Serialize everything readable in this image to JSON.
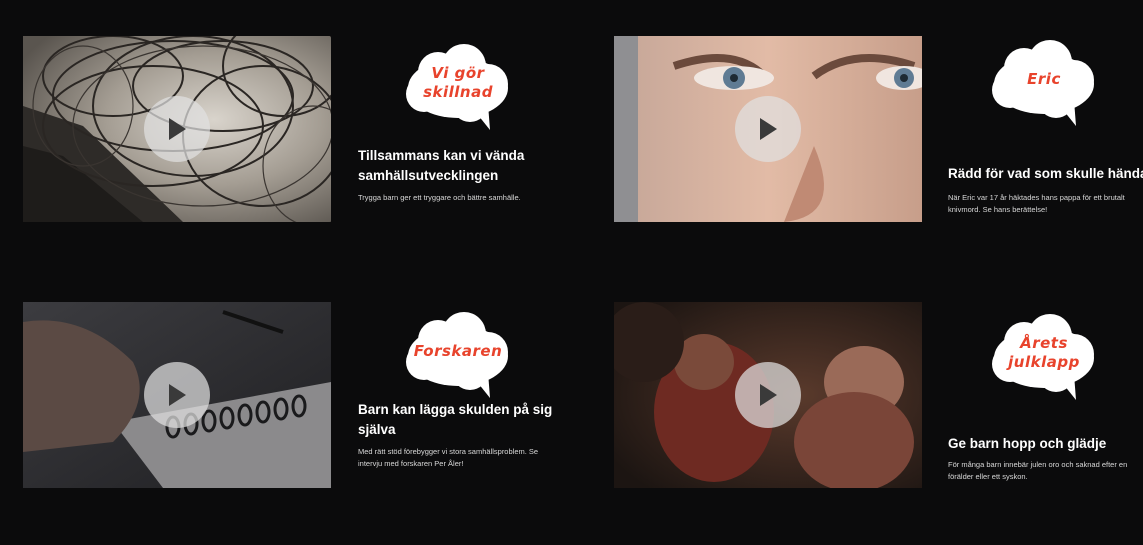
{
  "cards": [
    {
      "cloud_text": "Vi gör skillnad",
      "title": "Tillsammans kan vi vända samhällsutvecklingen",
      "desc": "Trygga barn ger ett tryggare och bättre samhälle."
    },
    {
      "cloud_text": "Eric",
      "title": "Rädd för vad som skulle hända",
      "desc": "När Eric var 17 år häktades hans pappa för ett brutalt knivmord. Se hans berättelse!"
    },
    {
      "cloud_text": "Forskaren",
      "title": "Barn kan lägga skulden på sig själva",
      "desc": "Med rätt stöd förebygger vi stora samhällsproblem. Se intervju med forskaren Per Åler!"
    },
    {
      "cloud_text": "Årets julklapp",
      "title": "Ge barn hopp och glädje",
      "desc": "För många barn innebär julen oro och saknad efter en förälder eller ett syskon."
    }
  ],
  "colors": {
    "background": "#0b0b0c",
    "cloud_text": "#e8432c",
    "cloud_fill": "#ffffff",
    "play_button": "#e1e1e1"
  },
  "icons": {
    "play": "play-icon",
    "cloud": "speech-cloud-icon"
  }
}
